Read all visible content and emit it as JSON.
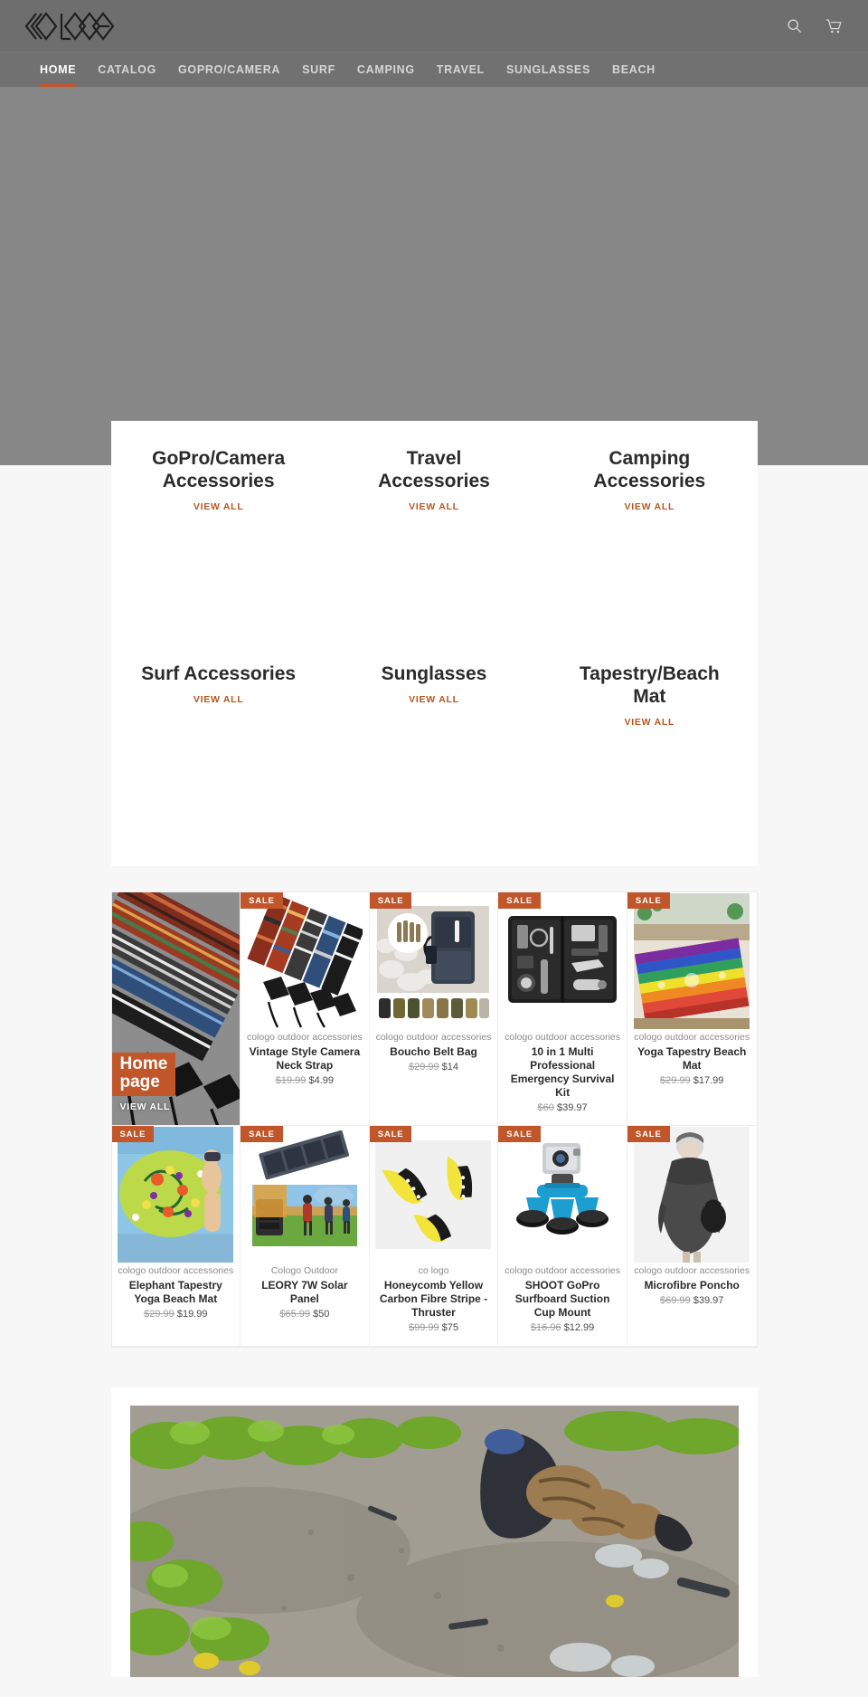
{
  "header": {
    "logo_text": "COLOGO",
    "logo_name": "cologo-logo",
    "search_icon": "search-icon",
    "cart_icon": "cart-icon"
  },
  "nav": {
    "items": [
      {
        "label": "HOME",
        "active": true
      },
      {
        "label": "CATALOG",
        "active": false
      },
      {
        "label": "GOPRO/CAMERA",
        "active": false
      },
      {
        "label": "SURF",
        "active": false
      },
      {
        "label": "CAMPING",
        "active": false
      },
      {
        "label": "TRAVEL",
        "active": false
      },
      {
        "label": "SUNGLASSES",
        "active": false
      },
      {
        "label": "BEACH",
        "active": false
      }
    ]
  },
  "categories": {
    "view_all_label": "VIEW ALL",
    "items": [
      {
        "title": "GoPro/Camera Accessories"
      },
      {
        "title": "Travel Accessories"
      },
      {
        "title": "Camping Accessories"
      },
      {
        "title": "Surf Accessories"
      },
      {
        "title": "Sunglasses"
      },
      {
        "title": "Tapestry/Beach Mat"
      }
    ]
  },
  "promo": {
    "title_line1": "Home",
    "title_line2": "page",
    "view_all_label": "VIEW ALL"
  },
  "products": {
    "sale_badge_label": "SALE",
    "items": [
      {
        "vendor": "cologo outdoor accessories",
        "title": "Vintage Style Camera Neck Strap",
        "price_old": "$19.99",
        "price_new": "$4.99",
        "on_sale": true
      },
      {
        "vendor": "cologo outdoor accessories",
        "title": "Boucho Belt Bag",
        "price_old": "$29.99",
        "price_new": "$14",
        "on_sale": true
      },
      {
        "vendor": "cologo outdoor accessories",
        "title": "10 in 1 Multi Professional Emergency Survival Kit",
        "price_old": "$60",
        "price_new": "$39.97",
        "on_sale": true
      },
      {
        "vendor": "cologo outdoor accessories",
        "title": "Yoga Tapestry Beach Mat",
        "price_old": "$29.99",
        "price_new": "$17.99",
        "on_sale": true
      },
      {
        "vendor": "cologo outdoor accessories",
        "title": "Elephant Tapestry Yoga Beach Mat",
        "price_old": "$29.99",
        "price_new": "$19.99",
        "on_sale": true
      },
      {
        "vendor": "Cologo Outdoor",
        "title": "LEORY 7W Solar Panel",
        "price_old": "$65.99",
        "price_new": "$50",
        "on_sale": true
      },
      {
        "vendor": "co logo",
        "title": "Honeycomb Yellow Carbon Fibre Stripe - Thruster",
        "price_old": "$99.99",
        "price_new": "$75",
        "on_sale": true
      },
      {
        "vendor": "cologo outdoor accessories",
        "title": "SHOOT GoPro Surfboard Suction Cup Mount",
        "price_old": "$16.96",
        "price_new": "$12.99",
        "on_sale": true
      },
      {
        "vendor": "cologo outdoor accessories",
        "title": "Microfibre Poncho",
        "price_old": "$69.99",
        "price_new": "$39.97",
        "on_sale": true
      }
    ]
  },
  "colors": {
    "accent": "#c0562a",
    "header_bg": "#6e6e6e",
    "nav_bg": "#717171",
    "hero_bg": "#878787",
    "page_bg": "#f7f7f7",
    "view_all": "#b7561f"
  }
}
